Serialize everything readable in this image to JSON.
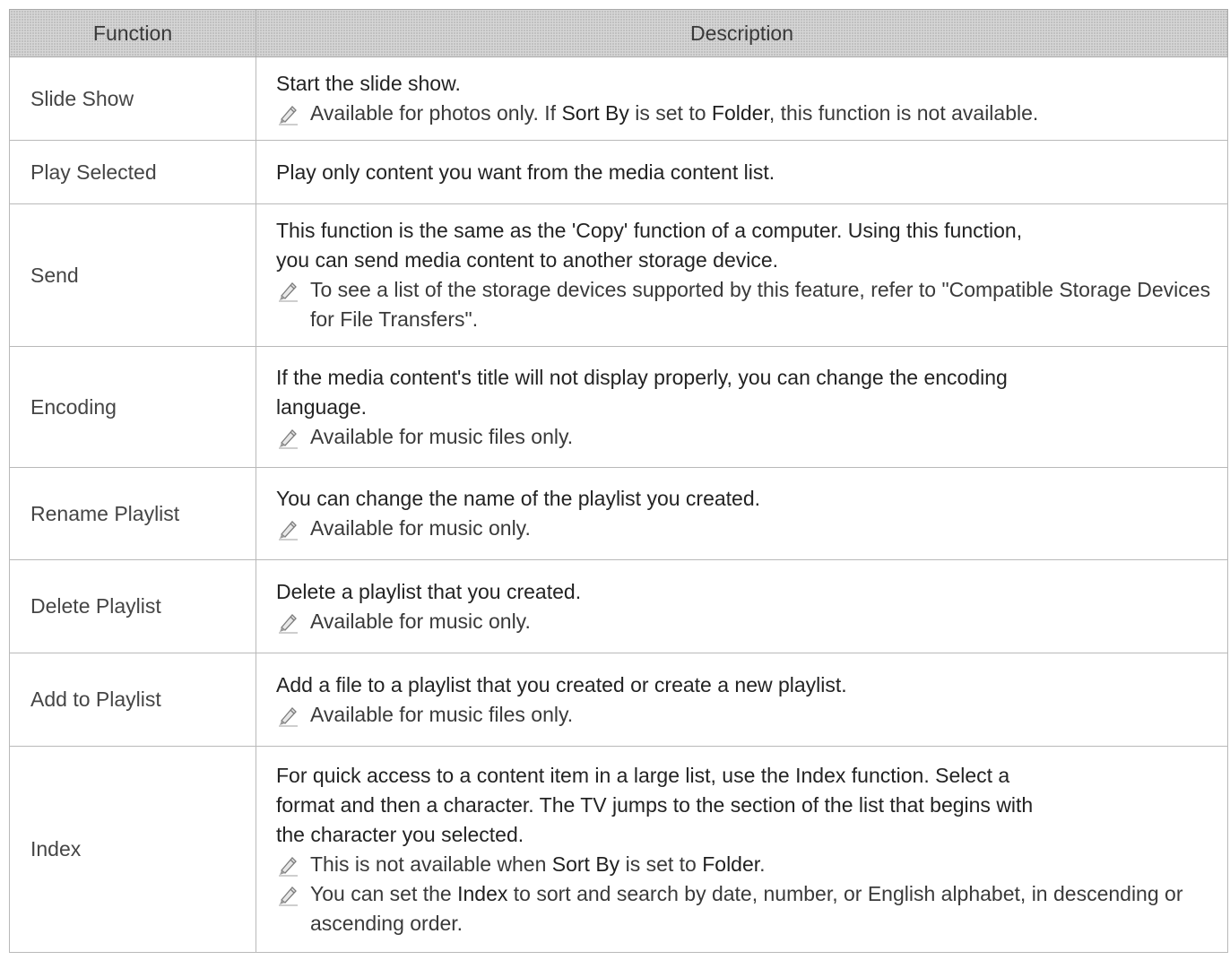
{
  "table": {
    "headers": {
      "function": "Function",
      "description": "Description"
    },
    "rows": [
      {
        "function": "Slide Show",
        "lines": [
          "Start the slide show."
        ],
        "notes": [
          {
            "parts": [
              "Available for photos only. If ",
              "Sort By",
              " is set to ",
              "Folder",
              ", this function is not available."
            ]
          }
        ]
      },
      {
        "function": "Play Selected",
        "lines": [
          "Play only content you want from the media content list."
        ],
        "notes": []
      },
      {
        "function": "Send",
        "lines": [
          "This function is the same as the 'Copy' function of a computer. Using this function,",
          "you can send media content to another storage device."
        ],
        "notes": [
          {
            "parts": [
              "To see a list of the storage devices supported by this feature, refer to \"Compatible Storage Devices for File Transfers\"."
            ]
          }
        ]
      },
      {
        "function": "Encoding",
        "lines": [
          "If the media content's title will not display properly, you can change the encoding",
          "language."
        ],
        "notes": [
          {
            "parts": [
              "Available for music files only."
            ]
          }
        ]
      },
      {
        "function": "Rename Playlist",
        "lines": [
          "You can change the name of the playlist you created."
        ],
        "notes": [
          {
            "parts": [
              "Available for music only."
            ]
          }
        ]
      },
      {
        "function": "Delete Playlist",
        "lines": [
          "Delete a playlist that you created."
        ],
        "notes": [
          {
            "parts": [
              "Available for music only."
            ]
          }
        ]
      },
      {
        "function": "Add to Playlist",
        "lines": [
          "Add a file to a playlist that you created or create a new playlist."
        ],
        "notes": [
          {
            "parts": [
              "Available for music files only."
            ]
          }
        ]
      },
      {
        "function": "Index",
        "lines": [
          "For quick access to a content item in a large list, use the Index function. Select a",
          "format and then a character. The TV jumps to the section of the list that begins with",
          "the character you selected."
        ],
        "notes": [
          {
            "parts": [
              "This is not available when ",
              "Sort By",
              " is set to ",
              "Folder",
              "."
            ]
          },
          {
            "parts": [
              "You can set the ",
              "Index",
              " to sort and search by date, number, or English alphabet, in descending or ascending order."
            ]
          }
        ]
      }
    ]
  },
  "icons": {
    "note": "pencil-note-icon"
  }
}
